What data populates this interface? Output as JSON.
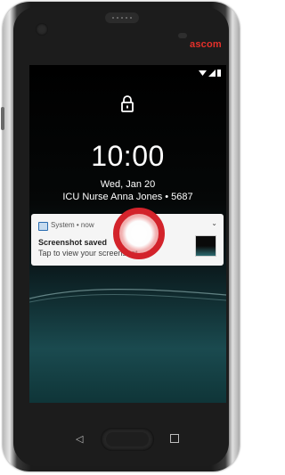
{
  "device": {
    "brand": "ascom"
  },
  "status_bar": {
    "icons": [
      "wifi-icon",
      "signal-icon",
      "battery-icon"
    ]
  },
  "lockscreen": {
    "time": "10:00",
    "date": "Wed, Jan 20",
    "owner_info": "ICU Nurse Anna Jones • 5687"
  },
  "notification": {
    "app": "System • now",
    "title": "Screenshot saved",
    "body": "Tap to view your screenshot."
  },
  "colors": {
    "brand": "#e5302a",
    "touch_indicator": "#d3232b"
  },
  "navigation": [
    "back-icon",
    "home-button",
    "recents-icon"
  ]
}
